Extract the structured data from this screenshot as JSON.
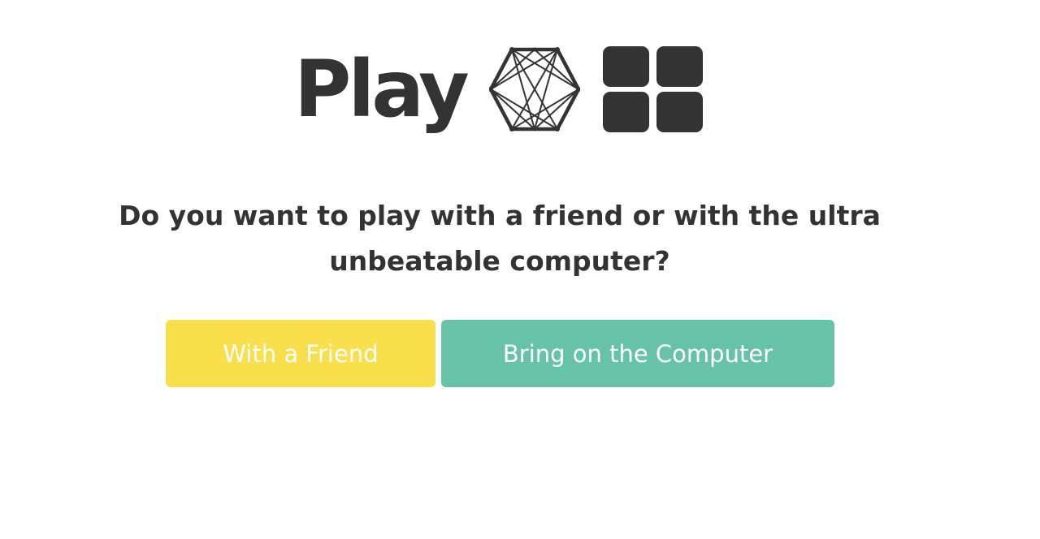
{
  "header": {
    "title": "Play",
    "icons": [
      "hexagon-network-icon",
      "four-squares-grid-icon"
    ],
    "icon_color": "#333333"
  },
  "prompt": {
    "question": "Do you want to play with a friend or with the ultra unbeatable computer?"
  },
  "actions": {
    "friend_label": "With a Friend",
    "friend_color": "#f9df4b",
    "computer_label": "Bring on the Computer",
    "computer_color": "#67c3a8"
  }
}
